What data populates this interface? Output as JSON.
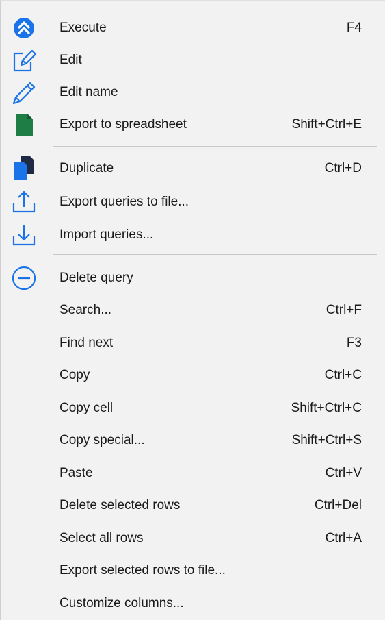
{
  "menu": {
    "items": [
      {
        "label": "Execute",
        "shortcut": "F4",
        "icon": "execute-chevrons-up-icon"
      },
      {
        "label": "Edit",
        "shortcut": "",
        "icon": "edit-pencil-box-icon"
      },
      {
        "label": "Edit name",
        "shortcut": "",
        "icon": "pencil-icon"
      },
      {
        "label": "Export to spreadsheet",
        "shortcut": "Shift+Ctrl+E",
        "icon": "spreadsheet-file-icon"
      },
      {
        "label": "Duplicate",
        "shortcut": "Ctrl+D",
        "icon": "duplicate-files-icon"
      },
      {
        "label": "Export queries to file...",
        "shortcut": "",
        "icon": "upload-arrow-icon"
      },
      {
        "label": "Import queries...",
        "shortcut": "",
        "icon": "download-arrow-icon"
      },
      {
        "label": "Delete query",
        "shortcut": "",
        "icon": "minus-circle-icon"
      },
      {
        "label": "Search...",
        "shortcut": "Ctrl+F"
      },
      {
        "label": "Find next",
        "shortcut": "F3"
      },
      {
        "label": "Copy",
        "shortcut": "Ctrl+C"
      },
      {
        "label": "Copy cell",
        "shortcut": "Shift+Ctrl+C"
      },
      {
        "label": "Copy special...",
        "shortcut": "Shift+Ctrl+S"
      },
      {
        "label": "Paste",
        "shortcut": "Ctrl+V"
      },
      {
        "label": "Delete selected rows",
        "shortcut": "Ctrl+Del"
      },
      {
        "label": "Select all rows",
        "shortcut": "Ctrl+A"
      },
      {
        "label": "Export selected rows to file...",
        "shortcut": ""
      },
      {
        "label": "Customize columns...",
        "shortcut": ""
      }
    ]
  },
  "colors": {
    "accent_blue": "#1a73e8",
    "spreadsheet_green": "#1e7d45",
    "dark_file": "#1f2a44",
    "separator": "#c9c9c9",
    "menu_bg": "#f2f2f2"
  }
}
